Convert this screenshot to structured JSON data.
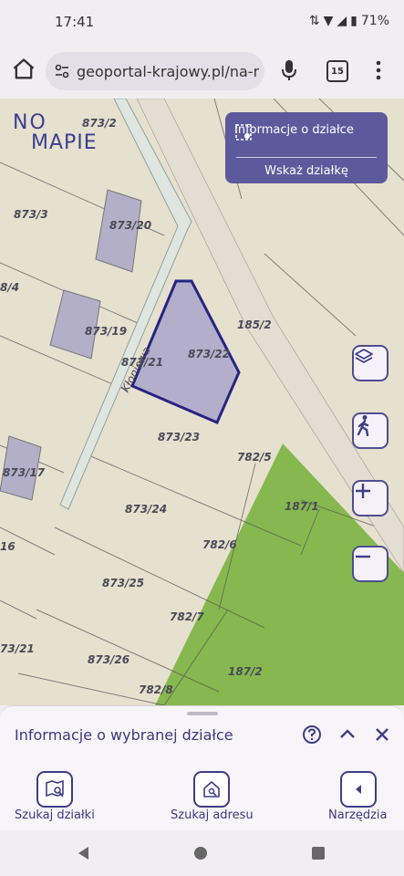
{
  "status": {
    "time": "17:41",
    "battery": "71%"
  },
  "browser": {
    "url": "geoportal-krajowy.pl/na-ma",
    "tab_count": "15"
  },
  "logo": {
    "line1": "NO",
    "line2": "MAPIE"
  },
  "panel": {
    "info_label": "Informacje o działce",
    "select_label": "Wskaż działkę"
  },
  "map": {
    "street_label": "Kłoniowa",
    "parcels": [
      "873/2",
      "873/3",
      "873/20",
      "8/4",
      "873/19",
      "873/21",
      "873/22",
      "185/2",
      "873/23",
      "782/5",
      "873/17",
      "187/1",
      "873/24",
      "16",
      "782/6",
      "873/25",
      "782/7",
      "73/21",
      "873/26",
      "187/2",
      "782/8"
    ]
  },
  "bottom_sheet": {
    "title": "Informacje o wybranej działce"
  },
  "nav": {
    "search_parcel": "Szukaj działki",
    "search_address": "Szukaj adresu",
    "tools": "Narzędzia"
  },
  "colors": {
    "accent": "#5c5a9c",
    "forest": "#86b84f",
    "parcel_fill": "#a9a6c9",
    "parcel_stroke": "#262482"
  }
}
